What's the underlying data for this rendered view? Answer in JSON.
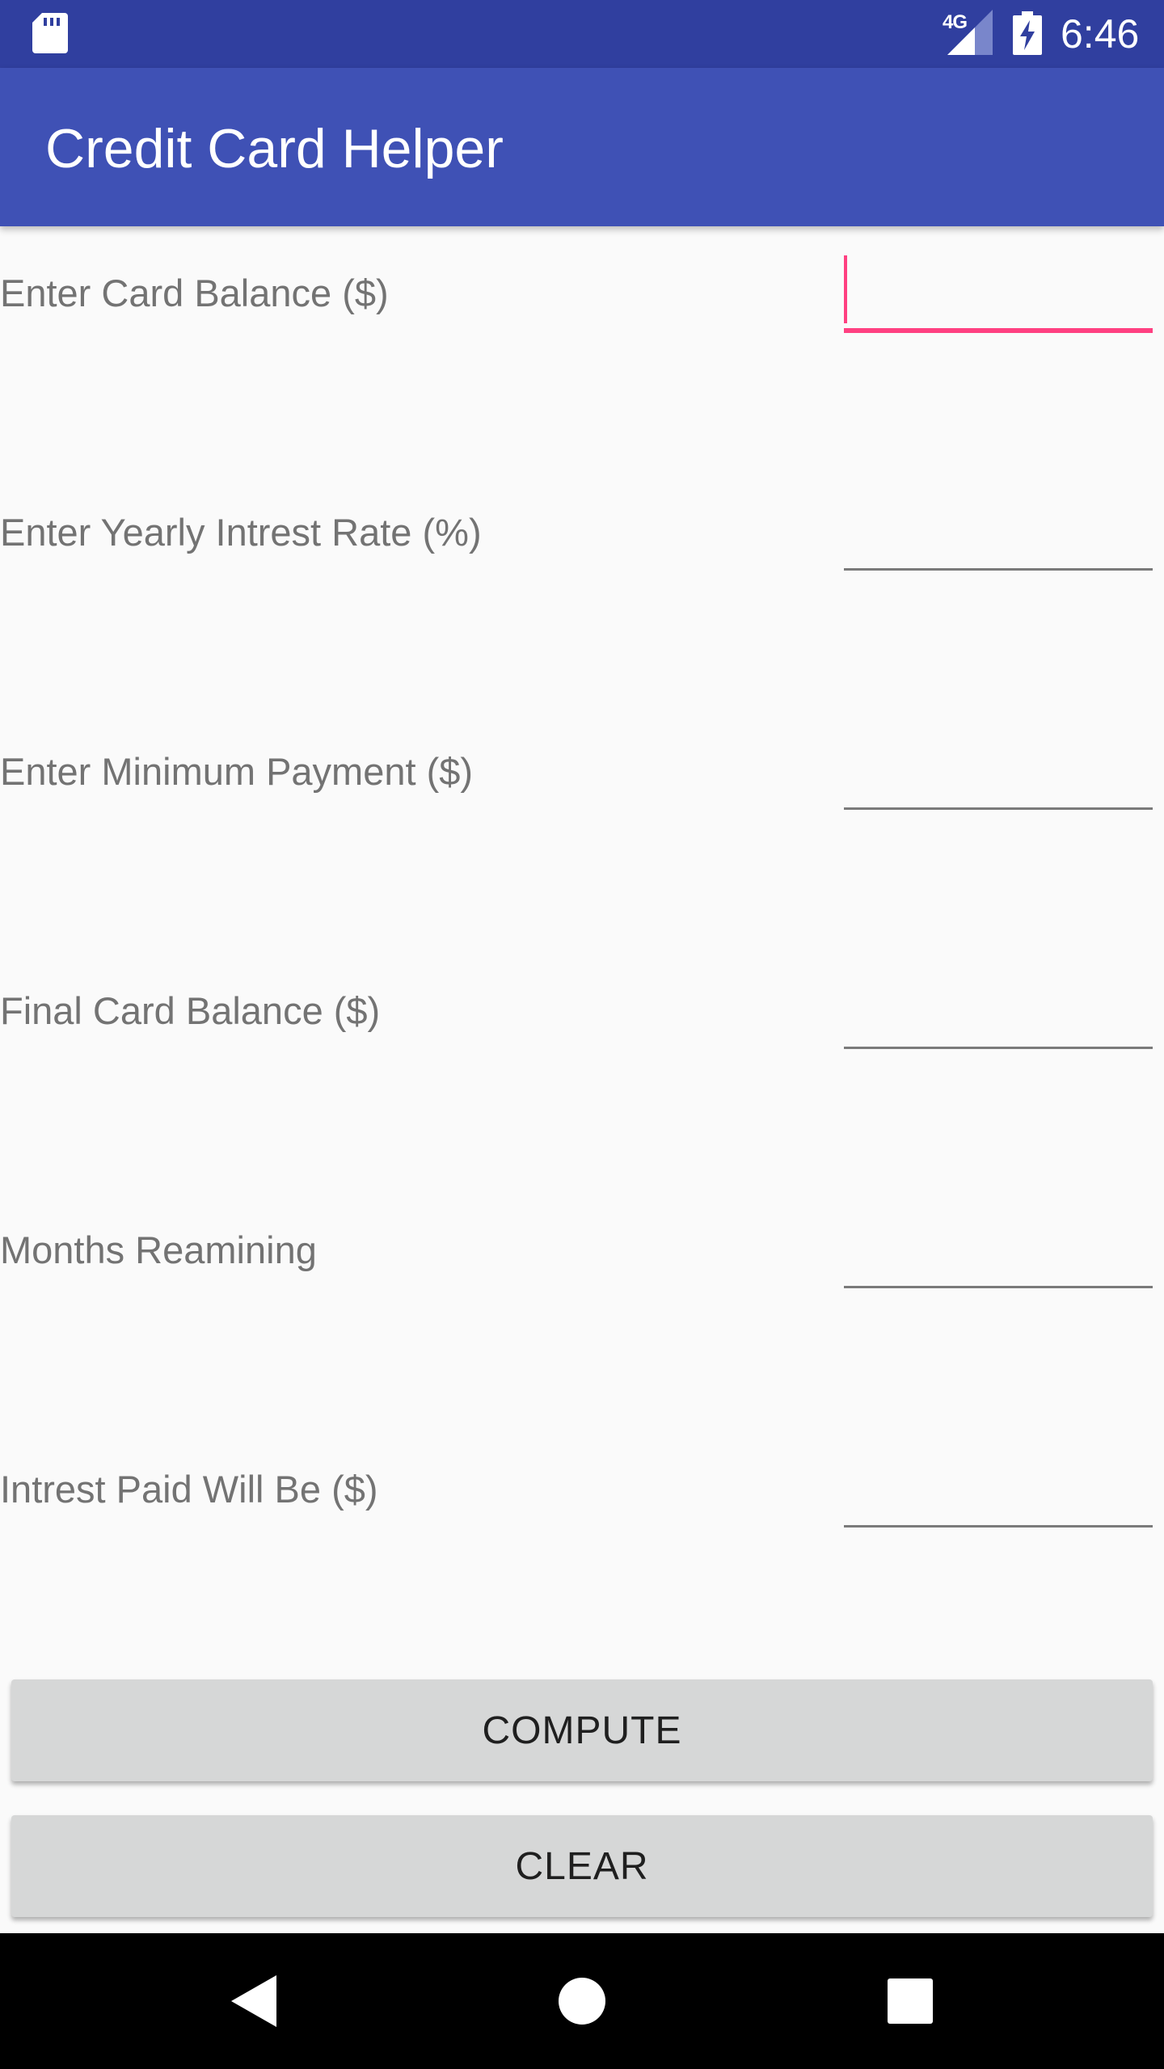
{
  "status_bar": {
    "time": "6:46",
    "network": "4G",
    "icons": [
      "sd-card-icon",
      "signal-icon",
      "battery-charging-icon"
    ]
  },
  "app_bar": {
    "title": "Credit Card Helper"
  },
  "fields": [
    {
      "label": "Enter Card Balance ($)",
      "value": "",
      "focused": true
    },
    {
      "label": "Enter Yearly Intrest Rate (%)",
      "value": ""
    },
    {
      "label": "Enter Minimum Payment ($)",
      "value": ""
    },
    {
      "label": "Final Card Balance ($)",
      "value": ""
    },
    {
      "label": "Months Reamining",
      "value": ""
    },
    {
      "label": "Intrest Paid Will Be ($)",
      "value": ""
    }
  ],
  "buttons": {
    "compute": "COMPUTE",
    "clear": "CLEAR"
  },
  "nav_bar": {
    "icons": [
      "back-icon",
      "home-icon",
      "recent-apps-icon"
    ]
  },
  "colors": {
    "status_bar": "#303F9F",
    "app_bar": "#3F51B5",
    "accent": "#FF4081",
    "background": "#FAFAFA",
    "button": "#D6D7D7"
  }
}
